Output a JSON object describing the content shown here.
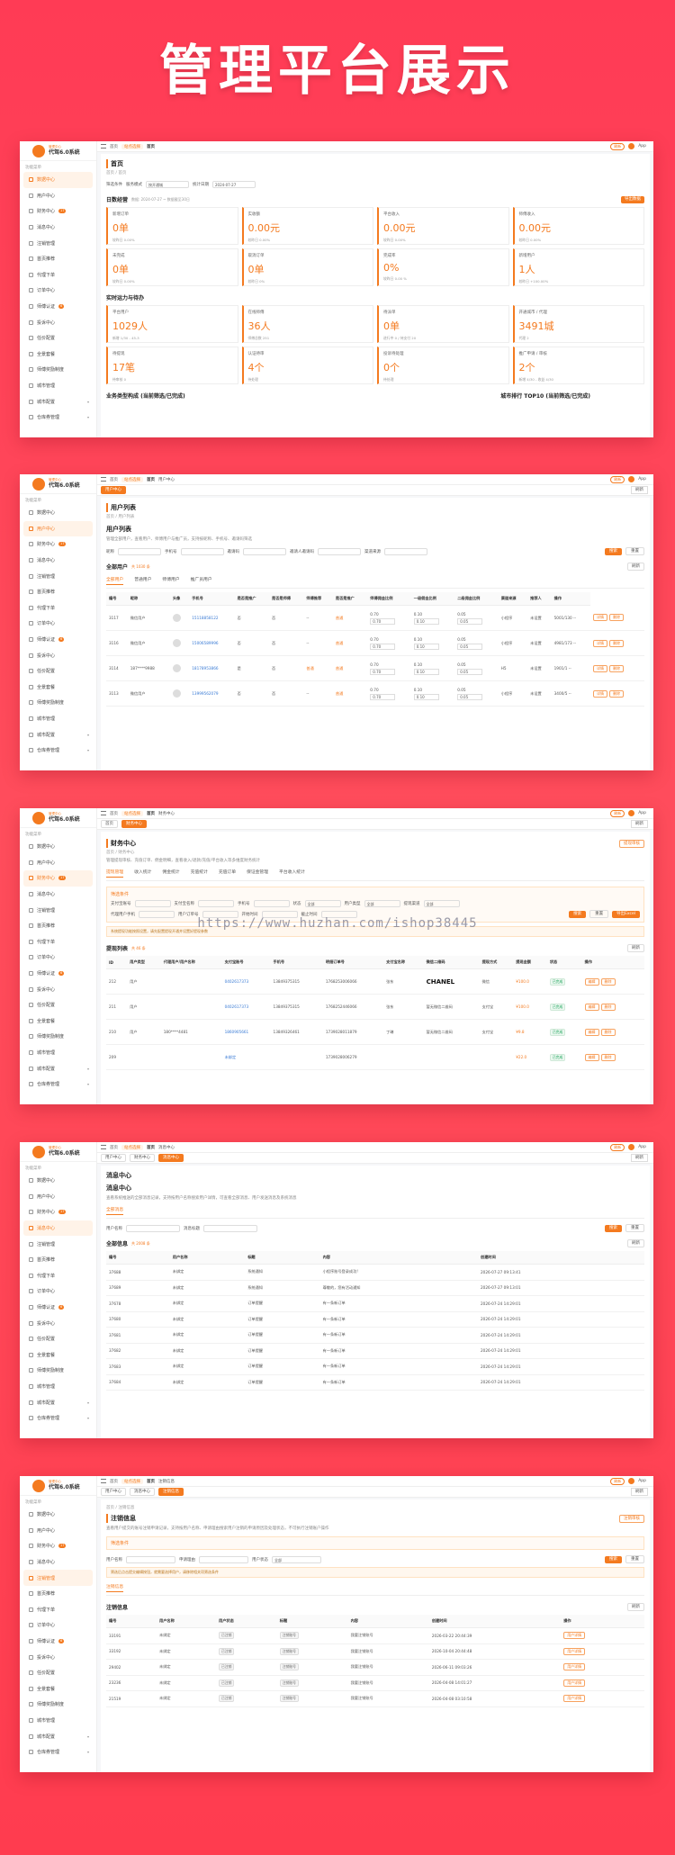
{
  "hero_title": "管理平台展示",
  "watermark": "https://www.huzhan.com/ishop38445",
  "brand": {
    "sub": "管理中心",
    "name": "代驾6.0系统"
  },
  "sidebar": {
    "section": "功能菜单",
    "items": [
      {
        "label": "数据中心"
      },
      {
        "label": "用户中心"
      },
      {
        "label": "财务中心",
        "badge": "17"
      },
      {
        "label": "消息中心"
      },
      {
        "label": "注销管理"
      },
      {
        "label": "首页推荐"
      },
      {
        "label": "代理下单"
      },
      {
        "label": "订单中心"
      },
      {
        "label": "师傅认证",
        "badge": "6"
      },
      {
        "label": "投诉中心"
      },
      {
        "label": "任价配置"
      },
      {
        "label": "全景套餐"
      },
      {
        "label": "师傅奖励制度"
      },
      {
        "label": "城市管理"
      },
      {
        "label": "城市配置"
      },
      {
        "label": "仓库券管理"
      }
    ]
  },
  "topbar": {
    "home": "首页",
    "tag": "站点选择",
    "user": "App",
    "btn": "刷新"
  },
  "screens": {
    "s1": {
      "tabs": [
        "首页"
      ],
      "title": "首页",
      "crumb": "首页 / 首页",
      "filter_labels": [
        "筛选条件",
        "服务模式",
        "统计日期"
      ],
      "filter_values": [
        "按开通城",
        "2024-07-27"
      ],
      "sec1": "日数经营",
      "sec1_sub": "数据: 2024-07-27 ~ 数据截至30日",
      "export": "导出数据",
      "stats1": [
        {
          "l": "新增订单",
          "v": "0单",
          "s": "较昨日 0.00%"
        },
        {
          "l": "实收额",
          "v": "0.00元",
          "s": "较昨日 0.00%"
        },
        {
          "l": "平台收入",
          "v": "0.00元",
          "s": "较昨日 0.00%"
        },
        {
          "l": "师傅收入",
          "v": "0.00元",
          "s": "较昨日 0.00%"
        },
        {
          "l": "未完成",
          "v": "0单",
          "s": "较昨日 0.00%"
        },
        {
          "l": "取消订单",
          "v": "0单",
          "s": "较昨日 0%"
        },
        {
          "l": "完成率",
          "v": "0%",
          "s": "较昨日 0.00 %"
        },
        {
          "l": "新增用户",
          "v": "1人",
          "s": "较昨日 +100.00%"
        }
      ],
      "sec2": "实时运力与待办",
      "stats2": [
        {
          "l": "平台用户",
          "v": "1029人",
          "s": "新增 1/30 - 45-3"
        },
        {
          "l": "在线师傅",
          "v": "36人",
          "s": "师傅总数 251"
        },
        {
          "l": "待派单",
          "v": "0单",
          "s": "进行中 0 / 待支付 20"
        },
        {
          "l": "开通城市 / 代理",
          "v": "3491城",
          "s": "代理 2"
        },
        {
          "l": "待提现",
          "v": "17笔",
          "s": "待审核 0"
        },
        {
          "l": "认证待审",
          "v": "4个",
          "s": "待处理"
        },
        {
          "l": "投诉待处理",
          "v": "0个",
          "s": "待处理"
        },
        {
          "l": "推广申请 / 审核",
          "v": "2个",
          "s": "新增 4/30 - 收益 4/30"
        }
      ],
      "sec3": "业务类型构成 (当前筛选/已完成)",
      "sec4": "城市排行 TOP10 (当前筛选/已完成)"
    },
    "s2": {
      "tabs": [
        "首页",
        "用户中心"
      ],
      "title": "用户列表",
      "crumb": "首页 / 用户列表",
      "desc": "管理全部用户，查看用户、师傅用户与推广员，支持按昵称、手机号、邀请码筛选",
      "filter_labels": [
        "昵称",
        "手机号",
        "邀请码",
        "邀请人邀请码",
        "渠道来源"
      ],
      "search": "搜索",
      "reset": "重置",
      "sec": "全部用户",
      "sec_count": "共 1030 条",
      "ftabs": [
        "全部用户",
        "普通用户",
        "师傅用户",
        "推广员用户"
      ],
      "headers": [
        "编号",
        "昵称",
        "头像",
        "手机号",
        "是否是推广",
        "是否是师傅",
        "师傅推荐",
        "是否是推广",
        "师傅佣金比例",
        "一级佣金比例",
        "二级佣金比例",
        "渠道来源",
        "推荐人",
        "操作"
      ],
      "rows": [
        [
          "3117",
          "微信用户",
          "",
          "15118858122",
          "否",
          "否",
          "--",
          "普通",
          "0.70",
          "0.10",
          "0.05",
          "小程序",
          "未设置",
          "5001/130 --"
        ],
        [
          "3116",
          "微信用户",
          "",
          "15006589996",
          "否",
          "否",
          "--",
          "普通",
          "0.70",
          "0.10",
          "0.05",
          "小程序",
          "未设置",
          "4981/173 --"
        ],
        [
          "3114",
          "187****9988",
          "",
          "18178953866",
          "是",
          "否",
          "普通",
          "普通",
          "0.70",
          "0.10",
          "0.05",
          "H5",
          "未设置",
          "1901/1 --"
        ],
        [
          "3113",
          "微信用户",
          "",
          "13999562079",
          "否",
          "否",
          "--",
          "普通",
          "0.70",
          "0.10",
          "0.05",
          "小程序",
          "未设置",
          "3400/5 --"
        ]
      ],
      "ops": [
        "详情",
        "删除"
      ]
    },
    "s3": {
      "tabs": [
        "首页",
        "财务中心"
      ],
      "title": "财务中心",
      "crumb": "首页 / 财务中心",
      "desc": "管理提现审核、充值订单、佣金明细，查看收入/退款/充值/平台收入等多维度财务统计",
      "btn": "提现审核",
      "ftabs": [
        "提现管理",
        "收入统计",
        "佣金统计",
        "充值统计",
        "充值订单",
        "保证金管理",
        "平台收入统计"
      ],
      "filter_title": "筛选条件",
      "filter_labels": [
        "支付宝账号",
        "支付宝名称",
        "手机号",
        "状态",
        "用户类型",
        "提现渠道",
        "代理用户手机",
        "用户订单号",
        "开始时间",
        "截止时间"
      ],
      "filter_values": [
        "全部",
        "全部",
        "全部"
      ],
      "search": "搜索",
      "reset": "重置",
      "export": "导出Excel",
      "note": "系统提现功能按照设置，请先配置提现开通并设置好提现参数",
      "sec": "提现列表",
      "sec_count": "共 46 条",
      "refresh": "刷新",
      "headers": [
        "ID",
        "用户类型",
        "代理用户/用户名称",
        "支付宝账号",
        "手机号",
        "明细订单号",
        "支付宝名称",
        "微信二维码",
        "提现方式",
        "提现金额",
        "状态",
        "操作"
      ],
      "rows": [
        [
          "212",
          "用户",
          "",
          "0402617373",
          "13849375315",
          "1768253006066",
          "张东",
          "CHANEL",
          "微信",
          "¥100.0",
          "已完成"
        ],
        [
          "211",
          "用户",
          "",
          "0402617373",
          "13849375315",
          "1768252446066",
          "张东",
          "暂无微信二维码",
          "支付宝",
          "¥100.0",
          "已完成"
        ],
        [
          "210",
          "用户",
          "180****4481",
          "1860905661",
          "13849326461",
          "1739028011879",
          "丁琳",
          "暂无微信二维码",
          "支付宝",
          "¥9.8",
          "已完成"
        ],
        [
          "209",
          "",
          "",
          "未绑定",
          "",
          "1739028006279",
          "",
          "",
          "",
          "¥22.0",
          "已完成"
        ]
      ],
      "ops": [
        "编辑",
        "删除"
      ]
    },
    "s4": {
      "tabs": [
        "首页",
        "用户中心",
        "财务中心",
        "消息中心"
      ],
      "title": "消息中心",
      "desc": "查看系统推送的全部消息记录，支持按用户名称搜索用户详情，可查看全部消息、用户发送消息及系统消息",
      "ftab": "全部消息",
      "filter_labels": [
        "用户名称",
        "消息标题"
      ],
      "search": "搜索",
      "reset": "重置",
      "sec": "全部信息",
      "sec_count": "共 2008 条",
      "refresh": "刷新",
      "headers": [
        "编号",
        "用户名称",
        "标题",
        "内容",
        "创建时间"
      ],
      "rows": [
        [
          "37688",
          "未绑定",
          "系统通知",
          "小程序账号登录成功!",
          "2026-07-27 09:13:41"
        ],
        [
          "37689",
          "未绑定",
          "系统通知",
          "尊敬的，您有活动通知",
          "2026-07-27 09:13:01"
        ],
        [
          "37678",
          "未绑定",
          "订单提醒",
          "有一条新订单",
          "2026-07-24 14:29:01"
        ],
        [
          "37680",
          "未绑定",
          "订单提醒",
          "有一条新订单",
          "2026-07-24 14:29:01"
        ],
        [
          "37681",
          "未绑定",
          "订单提醒",
          "有一条新订单",
          "2026-07-24 14:29:01"
        ],
        [
          "37682",
          "未绑定",
          "订单提醒",
          "有一条新订单",
          "2026-07-24 14:29:01"
        ],
        [
          "37683",
          "未绑定",
          "订单提醒",
          "有一条新订单",
          "2026-07-24 14:29:01"
        ],
        [
          "37684",
          "未绑定",
          "订单提醒",
          "有一条新订单",
          "2026-07-24 14:29:01"
        ]
      ]
    },
    "s5": {
      "tabs": [
        "首页",
        "用户中心",
        "消息中心",
        "注销信息"
      ],
      "title": "注销信息",
      "crumb": "首页 / 注销信息",
      "desc": "查看用户提交的账号注销申请记录，支持按用户名称、申请理由搜索用户注销的申请原因及处理状态，不可执行注销账户操作",
      "btn": "注销审核",
      "filter_title": "筛选条件",
      "filter_labels": [
        "用户名称",
        "申请理由",
        "用户状态"
      ],
      "filter_value": "全部",
      "search": "搜索",
      "reset": "重置",
      "note": "筛选后点击提交编辑按钮，就需要选择用户，请移除相关项筛选条件",
      "ftab": "注销信息",
      "sec": "注销信息",
      "refresh": "刷新",
      "headers": [
        "编号",
        "用户名称",
        "用户状态",
        "标题",
        "内容",
        "创建时间",
        "操作"
      ],
      "rows": [
        [
          "33191",
          "未绑定",
          "已注销",
          "注销账号",
          "我要注销账号",
          "2026-03-22 20:44:39"
        ],
        [
          "33192",
          "未绑定",
          "已注销",
          "注销账号",
          "我要注销账号",
          "2026-10-04 20:44:48"
        ],
        [
          "29402",
          "未绑定",
          "已注销",
          "注销账号",
          "我要注销账号",
          "2026-06-11 09:03:26"
        ],
        [
          "23236",
          "未绑定",
          "已注销",
          "注销账号",
          "我要注销账号",
          "2026-04-08 14:01:27"
        ],
        [
          "21519",
          "未绑定",
          "已注销",
          "注销账号",
          "我要注销账号",
          "2026-04-08 03:10:58"
        ]
      ],
      "op": "用户详情"
    }
  }
}
